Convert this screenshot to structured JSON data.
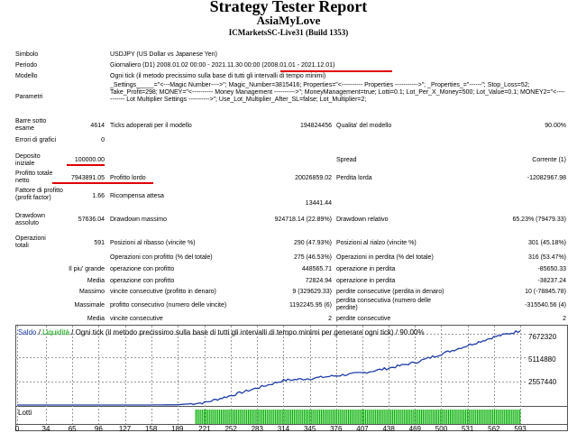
{
  "header": {
    "title": "Strategy Tester Report",
    "subtitle": "AsiaMyLove",
    "server": "ICMarketsSC-Live31 (Build 1353)"
  },
  "info": {
    "simbolo_label": "Simbolo",
    "simbolo": "USDJPY (US Dollar vs Japanese Yen)",
    "periodo_label": "Periodo",
    "periodo": "Giornaliero (D1) 2008.01.02 00:00 - 2021.11.30 00:00",
    "periodo_range": "(2008.01.01 - 2021.12.01)",
    "modello_label": "Modello",
    "modello": "Ogni tick (il metodo precissimo sulla base di tutti gli intervalli di tempo minimi)",
    "parametri_label": "Parametri",
    "parametri": "_Settings_____=\"<---Magic Number---->\"; Magic_Number=3815416; Properties=\"<---------- Properties ----------->\"; _Properties_=\"------\"; Stop_Loss=52; Take_Profit=298; MONEY=\"<---------- Money Management ---------->\"; MoneyManagement=true; Lotti=0.1; Lot_Per_X_Money=500; Lot_Value=0.1; MONEY2=\"<----------- Lot Multiplier Settings ---------->\"; Use_Lot_Multiplier_After_SL=false; Lot_Multiplier=2;",
    "barre_label": "Barre sotto esame",
    "barre": "4614",
    "ticks_label": "Ticks adoperati per il modello",
    "ticks": "194824456",
    "qualita_label": "Qualita' del modello",
    "qualita": "90.00%",
    "errori_label": "Errori di grafici",
    "errori": "0"
  },
  "stats": {
    "deposito_label": "Deposito iniziale",
    "deposito": "100000.00",
    "spread_label": "Spread",
    "spread": "Corrente (1)",
    "profitto_netto_label": "Profitto totale netto",
    "profitto_netto": "7943891.05",
    "profitto_lordo_label": "Profitto lordo",
    "profitto_lordo": "20026859.02",
    "perdita_lorda_label": "Perdita lorda",
    "perdita_lorda": "-12082967.98",
    "fattore_label": "Fattore di profitto (profit factor)",
    "fattore": "1.66",
    "ricompensa_label": "Ricompensa attesa",
    "ricompensa": "13441.44",
    "dd_ass_label": "Drawdown assoluto",
    "dd_ass": "57636.04",
    "dd_max_label": "Drawdown massimo",
    "dd_max": "924718.14 (22.89%)",
    "dd_rel_label": "Drawdown relativo",
    "dd_rel": "65.23% (79479.33)",
    "op_tot_label": "Operazioni totali",
    "op_tot": "591",
    "ribasso_label": "Posizioni al ribasso (vincite %)",
    "ribasso": "290 (47.93%)",
    "rialzo_label": "Posizioni al rialzo (vincite %)",
    "rialzo": "301 (45.18%)",
    "op_prof_label": "Operazioni con profitto (% del totale)",
    "op_prof": "275 (46.53%)",
    "op_perd_label": "Operazioni in perdita (% del totale)",
    "op_perd": "316 (53.47%)",
    "grande_label": "Il piu' grande",
    "grande_prof_label": "operazione con profitto",
    "grande_prof": "448565.71",
    "grande_perd_label": "operazione in perdita",
    "grande_perd": "-85650.33",
    "media_label": "Media",
    "media_prof_label": "operazione con profitto",
    "media_prof": "72824.94",
    "media_perd_label": "operazione in perdita",
    "media_perd": "-38237.24",
    "massimo_label": "Massimo",
    "max_vinc_label": "vincite consecutive (profitto in denaro)",
    "max_vinc": "9 (329629.33)",
    "max_perd_label": "perdite consecutive (perdita in denaro)",
    "max_perd": "10 (-78845.78)",
    "massimale_label": "Massimale",
    "mass_prof_label": "profitto consecutivo (numero delle vincite)",
    "mass_prof": "1192245.95 (6)",
    "mass_perd_label": "perdita consecutiva (numero delle perdite)",
    "mass_perd": "-315540.56 (4)",
    "media2_label": "Media",
    "med_vinc_label": "vincite consecutive",
    "med_vinc": "2",
    "med_perd_label": "perdite consecutive",
    "med_perd": "2"
  },
  "chart_legend": {
    "saldo": "Saldo",
    "sep1": " / ",
    "liquidita": "Liquidità",
    "rest": " / Ogni tick (il metodo precissimo sulla base di tutti gli intervalli di tempo minimi per generare ogni tick) / 90.00%"
  },
  "chart_data": {
    "type": "line",
    "series": [
      {
        "name": "Saldo",
        "x": [
          0,
          34,
          65,
          96,
          127,
          158,
          189,
          221,
          252,
          283,
          314,
          345,
          376,
          407,
          438,
          469,
          500,
          531,
          562,
          593
        ],
        "values": [
          100000,
          100000,
          100000,
          100000,
          100000,
          100000,
          120000,
          350000,
          1100000,
          1900000,
          2700000,
          2900000,
          3200000,
          3500000,
          4000000,
          4600000,
          5500000,
          6400000,
          7300000,
          7943891
        ]
      }
    ],
    "yticks": [
      "7672320",
      "5114880",
      "2557440"
    ],
    "xticks": [
      "0",
      "34",
      "65",
      "96",
      "127",
      "158",
      "189",
      "221",
      "252",
      "283",
      "314",
      "345",
      "376",
      "407",
      "438",
      "469",
      "500",
      "531",
      "562",
      "593"
    ],
    "lotti_label": "Lotti",
    "colors": {
      "saldo": "#1f3ca8",
      "lotti": "#00b000",
      "grid": "#9a9a9a"
    }
  }
}
